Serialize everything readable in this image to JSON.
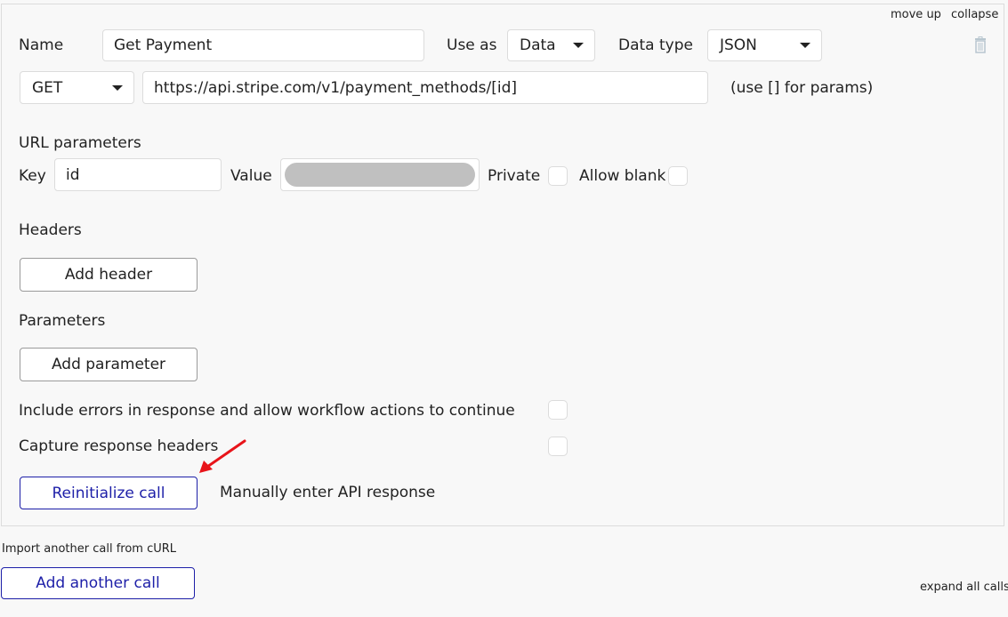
{
  "call": {
    "top_links": {
      "move_up": "move up",
      "collapse": "collapse"
    },
    "name_label": "Name",
    "name_value": "Get Payment",
    "use_as_label": "Use as",
    "use_as_value": "Data",
    "data_type_label": "Data type",
    "data_type_value": "JSON",
    "delete_icon": "trash-icon",
    "method_value": "GET",
    "url_value": "https://api.stripe.com/v1/payment_methods/[id]",
    "url_hint": "(use [] for params)",
    "url_params": {
      "title": "URL parameters",
      "key_label": "Key",
      "key_value": "id",
      "value_label": "Value",
      "value_redacted": true,
      "private_label": "Private",
      "private_checked": false,
      "allow_blank_label": "Allow blank",
      "allow_blank_checked": false
    },
    "headers": {
      "title": "Headers",
      "add_label": "Add header"
    },
    "parameters": {
      "title": "Parameters",
      "add_label": "Add parameter"
    },
    "include_errors": {
      "label": "Include errors in response and allow workflow actions to continue",
      "checked": false
    },
    "capture_headers": {
      "label": "Capture response headers",
      "checked": false
    },
    "reinitialize_label": "Reinitialize call",
    "manual_response_label": "Manually enter API response",
    "annotation": {
      "type": "arrow",
      "color": "#e8141a",
      "points_to": "reinitialize-call-button"
    }
  },
  "footer": {
    "import_curl": "Import another call from cURL",
    "add_call_label": "Add another call",
    "expand_all": "expand all calls"
  },
  "colors": {
    "primary": "#1d1fa8",
    "background": "#f8f8f8",
    "border": "#dcdcdc",
    "annotation": "#e8141a"
  }
}
